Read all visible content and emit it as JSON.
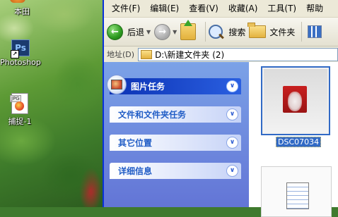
{
  "desktop": {
    "icons": [
      {
        "label": "本田"
      },
      {
        "label": "Photoshop",
        "badge": "Ps"
      },
      {
        "label": "捕捉-1",
        "badge": "JPG"
      }
    ]
  },
  "explorer": {
    "menu": [
      "文件(F)",
      "编辑(E)",
      "查看(V)",
      "收藏(A)",
      "工具(T)",
      "帮助"
    ],
    "toolbar": {
      "back_label": "后退",
      "search_label": "搜索",
      "folders_label": "文件夹"
    },
    "address": {
      "label": "地址(D)",
      "path": "D:\\新建文件夹 (2)"
    },
    "task_pane": {
      "groups": [
        {
          "title": "图片任务",
          "icon": "picture-tasks-icon"
        },
        {
          "title": "文件和文件夹任务",
          "icon": "chevron-down-icon"
        },
        {
          "title": "其它位置",
          "icon": "chevron-down-icon"
        },
        {
          "title": "详细信息",
          "icon": "chevron-down-icon"
        }
      ]
    },
    "files": [
      {
        "name": "DSC07034",
        "selected": true
      },
      {
        "name": ""
      }
    ]
  },
  "colors": {
    "selection": "#316ac5",
    "taskpane_top": "#7ba2e7",
    "taskpane_bottom": "#6375d6",
    "special_header": "#0c32b4"
  }
}
